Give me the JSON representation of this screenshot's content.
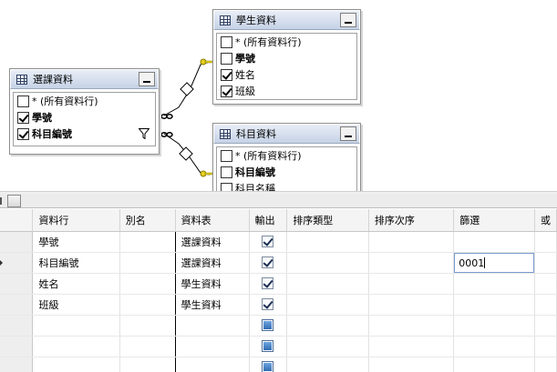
{
  "diagram": {
    "tables": [
      {
        "id": "course",
        "title": "選課資料",
        "rows": [
          {
            "label": "* (所有資料行)",
            "checked": false,
            "bold": false
          },
          {
            "label": "學號",
            "checked": true,
            "bold": true
          },
          {
            "label": "科目編號",
            "checked": true,
            "bold": true,
            "filter": true
          }
        ]
      },
      {
        "id": "student",
        "title": "學生資料",
        "rows": [
          {
            "label": "* (所有資料行)",
            "checked": false,
            "bold": false
          },
          {
            "label": "學號",
            "checked": false,
            "bold": true
          },
          {
            "label": "姓名",
            "checked": true,
            "bold": false
          },
          {
            "label": "班級",
            "checked": true,
            "bold": false
          }
        ]
      },
      {
        "id": "subject",
        "title": "科目資料",
        "rows": [
          {
            "label": "* (所有資料行)",
            "checked": false,
            "bold": false
          },
          {
            "label": "科目編號",
            "checked": false,
            "bold": true
          },
          {
            "label": "科目名稱",
            "checked": false,
            "bold": false
          }
        ]
      }
    ]
  },
  "grid": {
    "headers": [
      "資料行",
      "別名",
      "資料表",
      "輸出",
      "排序類型",
      "排序次序",
      "篩選",
      "或"
    ],
    "rows": [
      {
        "column": "學號",
        "alias": "",
        "table": "選課資料",
        "output": "checked",
        "sort_type": "",
        "sort_order": "",
        "filter": ""
      },
      {
        "column": "科目編號",
        "alias": "",
        "table": "選課資料",
        "output": "checked",
        "sort_type": "",
        "sort_order": "",
        "filter": "0001",
        "current": true
      },
      {
        "column": "姓名",
        "alias": "",
        "table": "學生資料",
        "output": "checked",
        "sort_type": "",
        "sort_order": "",
        "filter": ""
      },
      {
        "column": "班級",
        "alias": "",
        "table": "學生資料",
        "output": "checked",
        "sort_type": "",
        "sort_order": "",
        "filter": ""
      },
      {
        "column": "",
        "alias": "",
        "table": "",
        "output": "indeterminate",
        "sort_type": "",
        "sort_order": "",
        "filter": ""
      },
      {
        "column": "",
        "alias": "",
        "table": "",
        "output": "indeterminate",
        "sort_type": "",
        "sort_order": "",
        "filter": ""
      },
      {
        "column": "",
        "alias": "",
        "table": "",
        "output": "indeterminate",
        "sort_type": "",
        "sort_order": "",
        "filter": ""
      }
    ]
  },
  "colors": {
    "table_header_top": "#e9eef7",
    "table_header_bottom": "#c5d2e6",
    "relation_key": "#d8c21a",
    "edit_border": "#7b9bd1"
  }
}
